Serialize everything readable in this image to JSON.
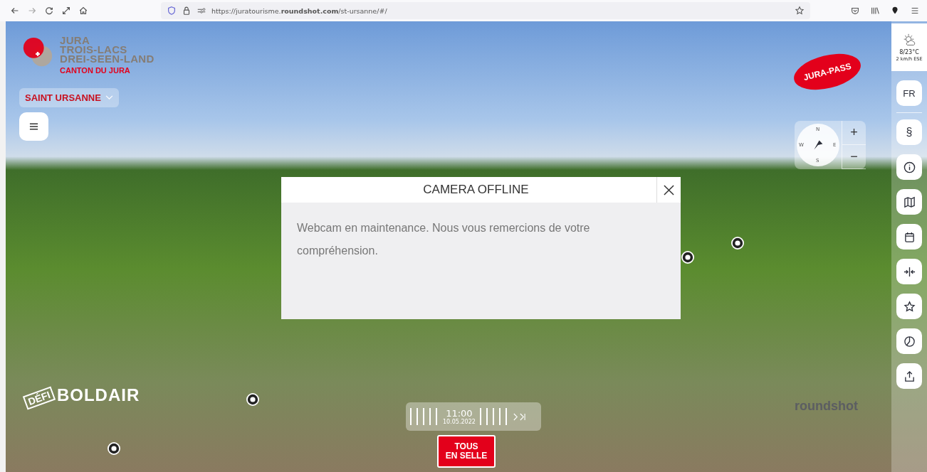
{
  "browser": {
    "url": "https://juratourisme.**roundshot.com**/st-ursanne/#/"
  },
  "brand": {
    "lines": [
      "JURA",
      "TROIS-LACS",
      "DREI-SEEN-LAND"
    ],
    "canton": "CANTON DU JURA"
  },
  "location": {
    "label": "SAINT URSANNE"
  },
  "weather": {
    "temperature": "8/23°C",
    "wind": "2 km/h ESE"
  },
  "language": "FR",
  "sidebar_text_button": "§",
  "jura_pass": {
    "title": "JURA-PASS"
  },
  "compass": {
    "north": "N",
    "east": "E",
    "south": "S",
    "west": "W"
  },
  "zoom": {
    "in": "+",
    "out": "−"
  },
  "modal": {
    "title": "CAMERA OFFLINE",
    "message": "Webcam en maintenance. Nous vous remercions de votre compréhension."
  },
  "timeline": {
    "time": "11:00",
    "date": "10.05.2022"
  },
  "defi": {
    "small": "DÉFI",
    "big": "BOLDAIR"
  },
  "tous_en_selle": {
    "line1": "TOUS",
    "line2": "EN SELLE"
  },
  "roundshot": {
    "label": "roundshot"
  }
}
